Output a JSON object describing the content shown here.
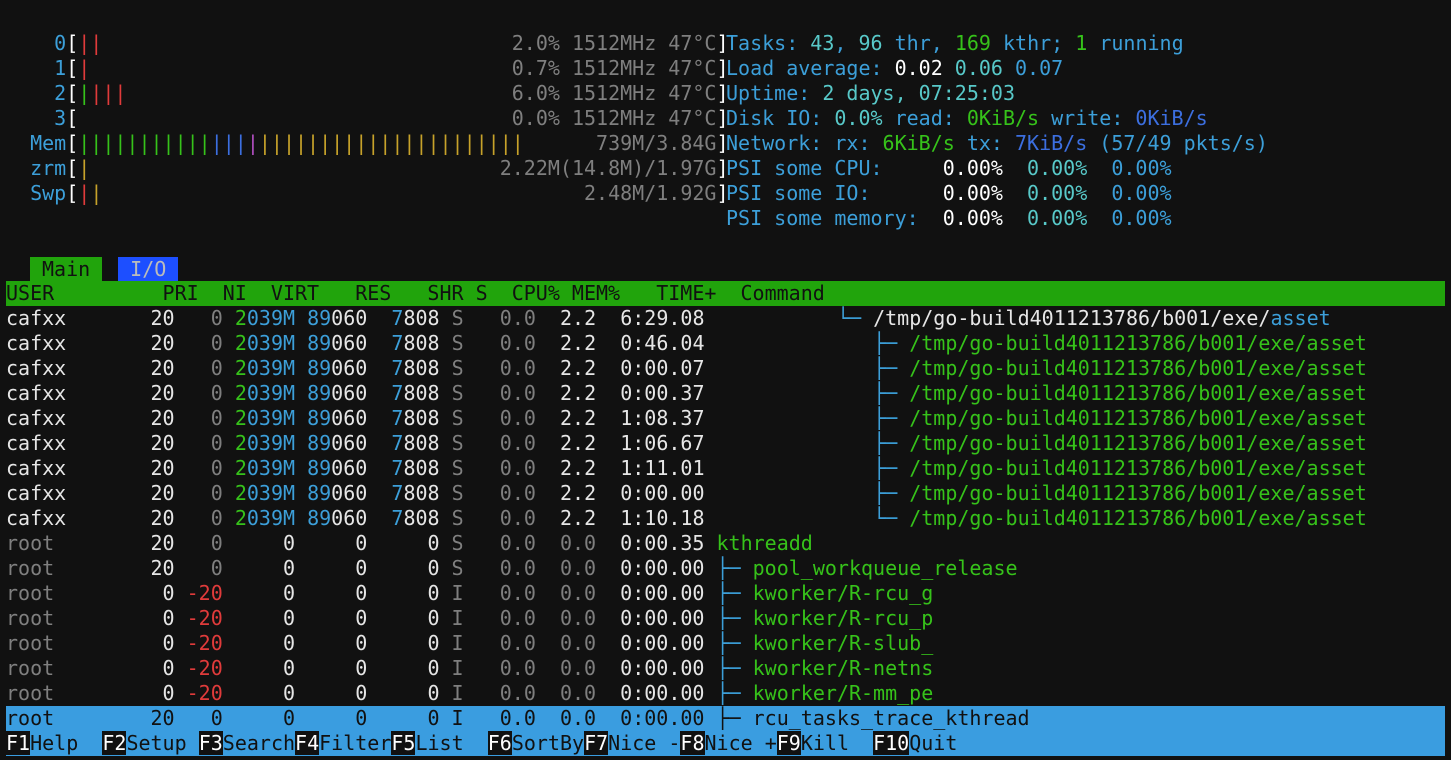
{
  "meters": {
    "cpus": [
      {
        "label": "0",
        "bars": [
          {
            "text": "||",
            "color": "#e03b3b"
          }
        ],
        "text": "2.0% 1512MHz 47°C"
      },
      {
        "label": "1",
        "bars": [
          {
            "text": "|",
            "color": "#e03b3b"
          }
        ],
        "text": "0.7% 1512MHz 47°C"
      },
      {
        "label": "2",
        "bars": [
          {
            "text": "|",
            "color": "#36c21a"
          },
          {
            "text": "|||",
            "color": "#e03b3b"
          }
        ],
        "text": "6.0% 1512MHz 47°C"
      },
      {
        "label": "3",
        "bars": [],
        "text": "0.0% 1512MHz 47°C"
      }
    ],
    "mem": {
      "label": "Mem",
      "text": "739M/3.84G"
    },
    "zrm": {
      "label": "zrm",
      "text": "2.22M(14.8M)/1.97G"
    },
    "swp": {
      "label": "Swp",
      "text": "2.48M/1.92G"
    }
  },
  "info": {
    "tasks_label": "Tasks: ",
    "tasks": "43",
    "thr": "96",
    "thr_label": " thr, ",
    "kthr": "169",
    "kthr_label": " kthr; ",
    "running": "1",
    "running_label": " running",
    "load_label": "Load average: ",
    "load1": "0.02",
    "load5": "0.06",
    "load15": "0.07",
    "uptime_label": "Uptime: ",
    "uptime": "2 days, 07:25:03",
    "disk_label": "Disk IO: ",
    "disk_pct": "0.0%",
    "disk_read_label": " read: ",
    "disk_read": "0KiB/s",
    "disk_write_label": " write: ",
    "disk_write": "0KiB/s",
    "net_label": "Network: rx: ",
    "net_rx": "6KiB/s",
    "net_tx_label": " tx: ",
    "net_tx": "7KiB/s",
    "net_pkts": " (57/49 pkts/s)",
    "psi_cpu_label": "PSI some CPU:    ",
    "psi_io_label": "PSI some IO:     ",
    "psi_mem_label": "PSI some memory: ",
    "psi_cpu": [
      "0.00%",
      "0.00%",
      "0.00%"
    ],
    "psi_io": [
      "0.00%",
      "0.00%",
      "0.00%"
    ],
    "psi_mem": [
      "0.00%",
      "0.00%",
      "0.00%"
    ]
  },
  "tabs": {
    "main": "Main",
    "io": "I/O"
  },
  "columns": "USER         PRI  NI  VIRT   RES   SHR S  CPU% MEM%   TIME+  Command",
  "rows": [
    {
      "user": "cafxx",
      "pri": "20",
      "ni": "0",
      "virt": "2039M",
      "res": "89060",
      "shr": "7808",
      "s": "S",
      "cpu": "0.0",
      "mem": "2.2",
      "time": "6:29.08",
      "tree": "          └─ ",
      "cmd_dir": "/tmp/go-build4011213786/b001/exe/",
      "cmd_base": "asset",
      "kind": "main"
    },
    {
      "user": "cafxx",
      "pri": "20",
      "ni": "0",
      "virt": "2039M",
      "res": "89060",
      "shr": "7808",
      "s": "S",
      "cpu": "0.0",
      "mem": "2.2",
      "time": "0:46.04",
      "tree": "             ├─ ",
      "cmd_dir": "/tmp/go-build4011213786/b001/exe/",
      "cmd_base": "asset",
      "kind": "thread"
    },
    {
      "user": "cafxx",
      "pri": "20",
      "ni": "0",
      "virt": "2039M",
      "res": "89060",
      "shr": "7808",
      "s": "S",
      "cpu": "0.0",
      "mem": "2.2",
      "time": "0:00.07",
      "tree": "             ├─ ",
      "cmd_dir": "/tmp/go-build4011213786/b001/exe/",
      "cmd_base": "asset",
      "kind": "thread"
    },
    {
      "user": "cafxx",
      "pri": "20",
      "ni": "0",
      "virt": "2039M",
      "res": "89060",
      "shr": "7808",
      "s": "S",
      "cpu": "0.0",
      "mem": "2.2",
      "time": "0:00.37",
      "tree": "             ├─ ",
      "cmd_dir": "/tmp/go-build4011213786/b001/exe/",
      "cmd_base": "asset",
      "kind": "thread"
    },
    {
      "user": "cafxx",
      "pri": "20",
      "ni": "0",
      "virt": "2039M",
      "res": "89060",
      "shr": "7808",
      "s": "S",
      "cpu": "0.0",
      "mem": "2.2",
      "time": "1:08.37",
      "tree": "             ├─ ",
      "cmd_dir": "/tmp/go-build4011213786/b001/exe/",
      "cmd_base": "asset",
      "kind": "thread"
    },
    {
      "user": "cafxx",
      "pri": "20",
      "ni": "0",
      "virt": "2039M",
      "res": "89060",
      "shr": "7808",
      "s": "S",
      "cpu": "0.0",
      "mem": "2.2",
      "time": "1:06.67",
      "tree": "             ├─ ",
      "cmd_dir": "/tmp/go-build4011213786/b001/exe/",
      "cmd_base": "asset",
      "kind": "thread"
    },
    {
      "user": "cafxx",
      "pri": "20",
      "ni": "0",
      "virt": "2039M",
      "res": "89060",
      "shr": "7808",
      "s": "S",
      "cpu": "0.0",
      "mem": "2.2",
      "time": "1:11.01",
      "tree": "             ├─ ",
      "cmd_dir": "/tmp/go-build4011213786/b001/exe/",
      "cmd_base": "asset",
      "kind": "thread"
    },
    {
      "user": "cafxx",
      "pri": "20",
      "ni": "0",
      "virt": "2039M",
      "res": "89060",
      "shr": "7808",
      "s": "S",
      "cpu": "0.0",
      "mem": "2.2",
      "time": "0:00.00",
      "tree": "             ├─ ",
      "cmd_dir": "/tmp/go-build4011213786/b001/exe/",
      "cmd_base": "asset",
      "kind": "thread"
    },
    {
      "user": "cafxx",
      "pri": "20",
      "ni": "0",
      "virt": "2039M",
      "res": "89060",
      "shr": "7808",
      "s": "S",
      "cpu": "0.0",
      "mem": "2.2",
      "time": "1:10.18",
      "tree": "             └─ ",
      "cmd_dir": "/tmp/go-build4011213786/b001/exe/",
      "cmd_base": "asset",
      "kind": "thread"
    },
    {
      "user": "root",
      "pri": "20",
      "ni": "0",
      "virt": "0",
      "res": "0",
      "shr": "0",
      "s": "S",
      "cpu": "0.0",
      "mem": "0.0",
      "time": "0:00.35",
      "tree": "",
      "cmd_dir": "",
      "cmd_base": "kthreadd",
      "kind": "kernel"
    },
    {
      "user": "root",
      "pri": "20",
      "ni": "0",
      "virt": "0",
      "res": "0",
      "shr": "0",
      "s": "S",
      "cpu": "0.0",
      "mem": "0.0",
      "time": "0:00.00",
      "tree": "├─ ",
      "cmd_dir": "",
      "cmd_base": "pool_workqueue_release",
      "kind": "kernel"
    },
    {
      "user": "root",
      "pri": "0",
      "ni": "-20",
      "virt": "0",
      "res": "0",
      "shr": "0",
      "s": "I",
      "cpu": "0.0",
      "mem": "0.0",
      "time": "0:00.00",
      "tree": "├─ ",
      "cmd_dir": "",
      "cmd_base": "kworker/R-rcu_g",
      "kind": "kernel"
    },
    {
      "user": "root",
      "pri": "0",
      "ni": "-20",
      "virt": "0",
      "res": "0",
      "shr": "0",
      "s": "I",
      "cpu": "0.0",
      "mem": "0.0",
      "time": "0:00.00",
      "tree": "├─ ",
      "cmd_dir": "",
      "cmd_base": "kworker/R-rcu_p",
      "kind": "kernel"
    },
    {
      "user": "root",
      "pri": "0",
      "ni": "-20",
      "virt": "0",
      "res": "0",
      "shr": "0",
      "s": "I",
      "cpu": "0.0",
      "mem": "0.0",
      "time": "0:00.00",
      "tree": "├─ ",
      "cmd_dir": "",
      "cmd_base": "kworker/R-slub_",
      "kind": "kernel"
    },
    {
      "user": "root",
      "pri": "0",
      "ni": "-20",
      "virt": "0",
      "res": "0",
      "shr": "0",
      "s": "I",
      "cpu": "0.0",
      "mem": "0.0",
      "time": "0:00.00",
      "tree": "├─ ",
      "cmd_dir": "",
      "cmd_base": "kworker/R-netns",
      "kind": "kernel"
    },
    {
      "user": "root",
      "pri": "0",
      "ni": "-20",
      "virt": "0",
      "res": "0",
      "shr": "0",
      "s": "I",
      "cpu": "0.0",
      "mem": "0.0",
      "time": "0:00.00",
      "tree": "├─ ",
      "cmd_dir": "",
      "cmd_base": "kworker/R-mm_pe",
      "kind": "kernel"
    },
    {
      "user": "root",
      "pri": "20",
      "ni": "0",
      "virt": "0",
      "res": "0",
      "shr": "0",
      "s": "I",
      "cpu": "0.0",
      "mem": "0.0",
      "time": "0:00.00",
      "tree": "├─ ",
      "cmd_dir": "",
      "cmd_base": "rcu_tasks_trace_kthread",
      "kind": "selected"
    }
  ],
  "fkeys": [
    {
      "key": "F1",
      "label": "Help  "
    },
    {
      "key": "F2",
      "label": "Setup "
    },
    {
      "key": "F3",
      "label": "Search"
    },
    {
      "key": "F4",
      "label": "Filter"
    },
    {
      "key": "F5",
      "label": "List  "
    },
    {
      "key": "F6",
      "label": "SortBy"
    },
    {
      "key": "F7",
      "label": "Nice -"
    },
    {
      "key": "F8",
      "label": "Nice +"
    },
    {
      "key": "F9",
      "label": "Kill  "
    },
    {
      "key": "F10",
      "label": "Quit"
    }
  ],
  "colors": {
    "header_bg": "#21a40c",
    "selected_bg": "#3a9de0",
    "bg": "#111111"
  }
}
